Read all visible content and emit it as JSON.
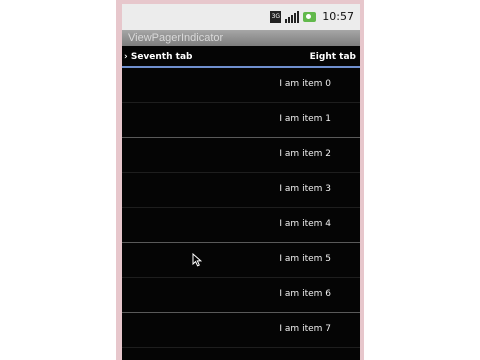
{
  "status_bar": {
    "time": "10:57",
    "icons": [
      "3g-icon",
      "signal-icon",
      "battery-charging-icon"
    ],
    "network_type": "3G"
  },
  "app": {
    "title": "ViewPagerIndicator"
  },
  "tabs": {
    "previous": "Seventh tab",
    "current": "Eight tab",
    "indicator_color": "#6f8fce"
  },
  "list": {
    "items": [
      "I am item 0",
      "I am item 1",
      "I am item 2",
      "I am item 3",
      "I am item 4",
      "I am item 5",
      "I am item 6",
      "I am item 7"
    ]
  },
  "colors": {
    "background": "#050505",
    "frame": "#e7c7cc",
    "text": "#f2f2f2"
  }
}
